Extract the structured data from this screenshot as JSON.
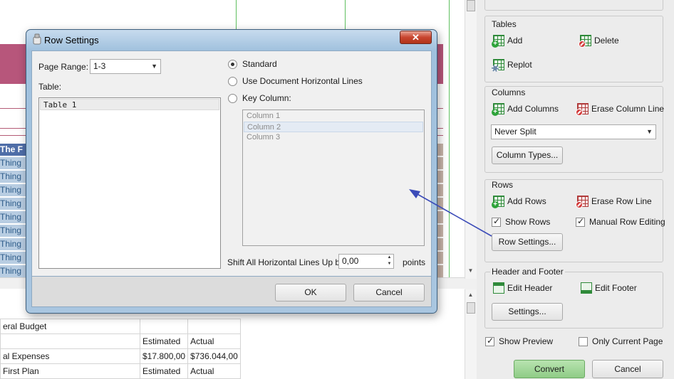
{
  "preview": {
    "header_cell": "The F",
    "row_label": "Thing"
  },
  "sheet": {
    "rows": [
      [
        "eral Budget",
        "",
        ""
      ],
      [
        "",
        "Estimated",
        "Actual"
      ],
      [
        "al Expenses",
        "$17.800,00",
        "$736.044,00"
      ],
      [
        " First Plan",
        "Estimated",
        "Actual"
      ]
    ]
  },
  "dialog": {
    "title": "Row Settings",
    "close_label": "✕",
    "page_range_label": "Page Range:",
    "page_range_value": "1-3",
    "table_label": "Table:",
    "tables": [
      "Table 1"
    ],
    "radio_standard": "Standard",
    "radio_doc_lines": "Use Document Horizontal Lines",
    "radio_key_column": "Key Column:",
    "columns": [
      "Column 1",
      "Column 2",
      "Column 3"
    ],
    "shift_label": "Shift All Horizontal Lines Up by",
    "shift_value": "0,00",
    "shift_unit": "points",
    "ok_label": "OK",
    "cancel_label": "Cancel"
  },
  "panel": {
    "tables": {
      "title": "Tables",
      "add": "Add",
      "delete": "Delete",
      "replot": "Replot"
    },
    "columns": {
      "title": "Columns",
      "add": "Add Columns",
      "erase": "Erase Column Line",
      "split_value": "Never Split",
      "types_button": "Column Types..."
    },
    "rows": {
      "title": "Rows",
      "add": "Add Rows",
      "erase": "Erase Row Line",
      "show_rows": "Show Rows",
      "manual_editing": "Manual Row Editing",
      "settings_button": "Row Settings..."
    },
    "header_footer": {
      "title": "Header and Footer",
      "edit_header": "Edit Header",
      "edit_footer": "Edit Footer",
      "settings_button": "Settings..."
    },
    "show_preview": "Show Preview",
    "only_current_page": "Only Current Page",
    "convert": "Convert",
    "cancel": "Cancel"
  },
  "colors": {
    "accent_arrow": "#3b4bb8",
    "maroon": "#b7567b",
    "convert_green": "#8fcc86"
  },
  "icons": [
    "table-add-icon",
    "table-delete-icon",
    "replot-icon",
    "column-add-icon",
    "column-erase-icon",
    "row-add-icon",
    "row-erase-icon",
    "edit-header-icon",
    "edit-footer-icon",
    "close-icon",
    "dropdown-arrow-icon"
  ]
}
